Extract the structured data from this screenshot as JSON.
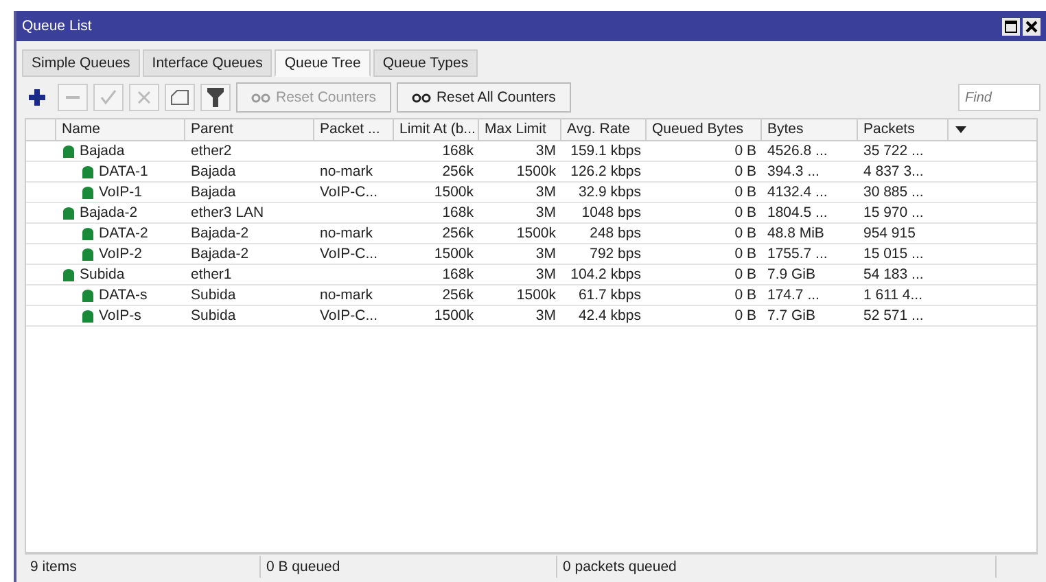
{
  "window": {
    "title": "Queue List"
  },
  "tabs": [
    {
      "label": "Simple Queues",
      "selected": false
    },
    {
      "label": "Interface Queues",
      "selected": false
    },
    {
      "label": "Queue Tree",
      "selected": true
    },
    {
      "label": "Queue Types",
      "selected": false
    }
  ],
  "toolbar": {
    "buttons": [
      {
        "kind": "add",
        "disabled": false
      },
      {
        "kind": "remove",
        "disabled": true
      },
      {
        "kind": "enable",
        "disabled": true
      },
      {
        "kind": "disable",
        "disabled": true
      },
      {
        "kind": "comment",
        "disabled": false
      },
      {
        "kind": "filter",
        "disabled": false
      }
    ],
    "reset_counters": {
      "label": "Reset Counters",
      "disabled": true
    },
    "reset_all_counters": {
      "label": "Reset All Counters",
      "disabled": false
    },
    "search": {
      "placeholder": "Find"
    }
  },
  "table": {
    "columns": [
      "Name",
      "Parent",
      "Packet ...",
      "Limit At (b...",
      "Max Limit",
      "Avg. Rate",
      "Queued Bytes",
      "Bytes",
      "Packets"
    ],
    "rows": [
      {
        "cells": [
          "Bajada",
          "ether2",
          "",
          "168k",
          "3M",
          "159.1 kbps",
          "0 B",
          "4526.8 ...",
          "35 722 ..."
        ],
        "children": [
          {
            "cells": [
              "DATA-1",
              "Bajada",
              "no-mark",
              "256k",
              "1500k",
              "126.2 kbps",
              "0 B",
              "394.3 ...",
              "4 837 3..."
            ]
          },
          {
            "cells": [
              "VoIP-1",
              "Bajada",
              "VoIP-C...",
              "1500k",
              "3M",
              "32.9 kbps",
              "0 B",
              "4132.4 ...",
              "30 885 ..."
            ]
          }
        ]
      },
      {
        "cells": [
          "Bajada-2",
          "ether3 LAN",
          "",
          "168k",
          "3M",
          "1048 bps",
          "0 B",
          "1804.5 ...",
          "15 970 ..."
        ],
        "children": [
          {
            "cells": [
              "DATA-2",
              "Bajada-2",
              "no-mark",
              "256k",
              "1500k",
              "248 bps",
              "0 B",
              "48.8 MiB",
              "954 915"
            ]
          },
          {
            "cells": [
              "VoIP-2",
              "Bajada-2",
              "VoIP-C...",
              "1500k",
              "3M",
              "792 bps",
              "0 B",
              "1755.7 ...",
              "15 015 ..."
            ]
          }
        ]
      },
      {
        "cells": [
          "Subida",
          "ether1",
          "",
          "168k",
          "3M",
          "104.2 kbps",
          "0 B",
          "7.9 GiB",
          "54 183 ..."
        ],
        "children": [
          {
            "cells": [
              "DATA-s",
              "Subida",
              "no-mark",
              "256k",
              "1500k",
              "61.7 kbps",
              "0 B",
              "174.7 ...",
              "1 611 4..."
            ]
          },
          {
            "cells": [
              "VoIP-s",
              "Subida",
              "VoIP-C...",
              "1500k",
              "3M",
              "42.4 kbps",
              "0 B",
              "7.7 GiB",
              "52 571 ..."
            ]
          }
        ]
      }
    ]
  },
  "status_bar": [
    "9 items",
    "0 B queued",
    "0 packets queued"
  ]
}
